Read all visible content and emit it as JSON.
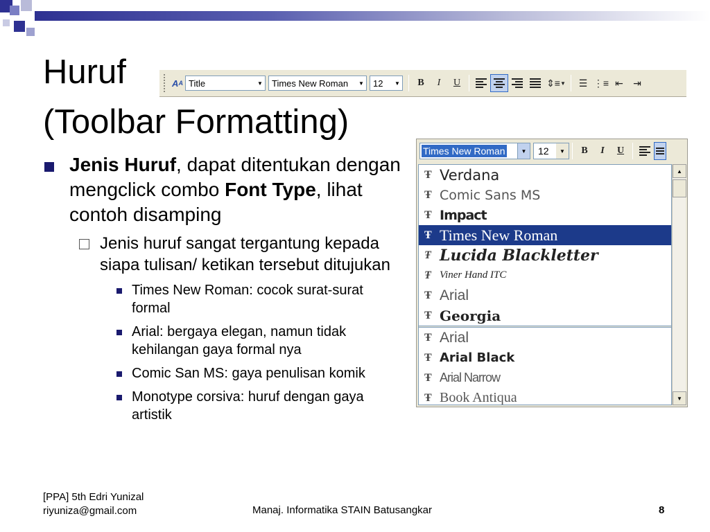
{
  "slide": {
    "title_line1": "Huruf",
    "title_line2": "(Toolbar Formatting)",
    "accent_color": "#1a1a6e"
  },
  "toolbar": {
    "style_value": "Title",
    "font_value": "Times New Roman",
    "size_value": "12",
    "bold_label": "B",
    "italic_label": "I",
    "underline_label": "U"
  },
  "bullets": {
    "main_bold1": "Jenis Huruf",
    "main_text1": ", dapat ditentukan dengan mengclick combo ",
    "main_bold2": "Font Type",
    "main_text2": ", lihat contoh disamping",
    "sub": "Jenis huruf sangat tergantung kepada siapa tulisan/ ketikan tersebut ditujukan",
    "items": [
      "Times New Roman: cocok surat-surat formal",
      "Arial: bergaya elegan, namun tidak kehilangan gaya formal nya",
      "Comic San MS: gaya penulisan komik",
      "Monotype corsiva: huruf dengan gaya artistik"
    ]
  },
  "font_panel": {
    "combo_value": "Times New Roman",
    "size_value": "12",
    "bold_label": "B",
    "italic_label": "I",
    "underline_label": "U",
    "recent_fonts": [
      "Verdana",
      "Comic Sans MS",
      "Impact",
      "Times New Roman",
      "Lucida Blackletter",
      "Viner Hand ITC",
      "Arial",
      "Georgia"
    ],
    "all_fonts": [
      "Arial",
      "Arial Black",
      "Arial Narrow",
      "Book Antiqua"
    ],
    "selected_font": "Times New Roman"
  },
  "footer": {
    "left_line1": "[PPA] 5th Edri Yunizal",
    "left_line2": "riyuniza@gmail.com",
    "center": "Manaj. Informatika STAIN Batusangkar",
    "page_number": "8"
  }
}
